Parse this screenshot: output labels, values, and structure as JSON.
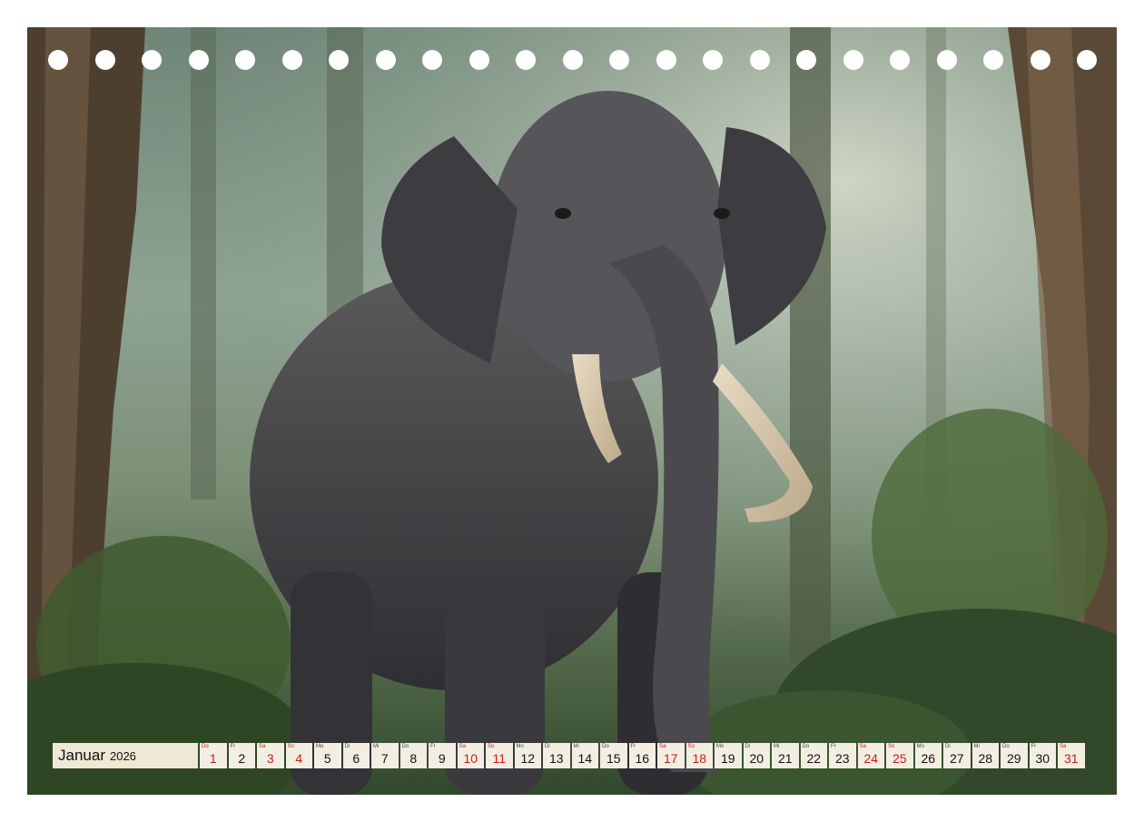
{
  "calendar": {
    "month": "Januar",
    "year": "2026",
    "days": [
      {
        "wd": "Do",
        "num": "1",
        "red": true
      },
      {
        "wd": "Fr",
        "num": "2",
        "red": false
      },
      {
        "wd": "Sa",
        "num": "3",
        "red": true
      },
      {
        "wd": "So",
        "num": "4",
        "red": true
      },
      {
        "wd": "Mo",
        "num": "5",
        "red": false
      },
      {
        "wd": "Di",
        "num": "6",
        "red": false
      },
      {
        "wd": "Mi",
        "num": "7",
        "red": false
      },
      {
        "wd": "Do",
        "num": "8",
        "red": false
      },
      {
        "wd": "Fr",
        "num": "9",
        "red": false
      },
      {
        "wd": "Sa",
        "num": "10",
        "red": true
      },
      {
        "wd": "So",
        "num": "11",
        "red": true
      },
      {
        "wd": "Mo",
        "num": "12",
        "red": false
      },
      {
        "wd": "Di",
        "num": "13",
        "red": false
      },
      {
        "wd": "Mi",
        "num": "14",
        "red": false
      },
      {
        "wd": "Do",
        "num": "15",
        "red": false
      },
      {
        "wd": "Fr",
        "num": "16",
        "red": false
      },
      {
        "wd": "Sa",
        "num": "17",
        "red": true
      },
      {
        "wd": "So",
        "num": "18",
        "red": true
      },
      {
        "wd": "Mo",
        "num": "19",
        "red": false
      },
      {
        "wd": "Di",
        "num": "20",
        "red": false
      },
      {
        "wd": "Mi",
        "num": "21",
        "red": false
      },
      {
        "wd": "Do",
        "num": "22",
        "red": false
      },
      {
        "wd": "Fr",
        "num": "23",
        "red": false
      },
      {
        "wd": "Sa",
        "num": "24",
        "red": true
      },
      {
        "wd": "So",
        "num": "25",
        "red": true
      },
      {
        "wd": "Mo",
        "num": "26",
        "red": false
      },
      {
        "wd": "Di",
        "num": "27",
        "red": false
      },
      {
        "wd": "Mi",
        "num": "28",
        "red": false
      },
      {
        "wd": "Do",
        "num": "29",
        "red": false
      },
      {
        "wd": "Fr",
        "num": "30",
        "red": false
      },
      {
        "wd": "Sa",
        "num": "31",
        "red": true
      }
    ]
  },
  "colors": {
    "weekend": "#cc1a1a",
    "cell_bg": "#f3eee2",
    "forest": "#6f8576",
    "elephant": "#4a4a4c"
  }
}
